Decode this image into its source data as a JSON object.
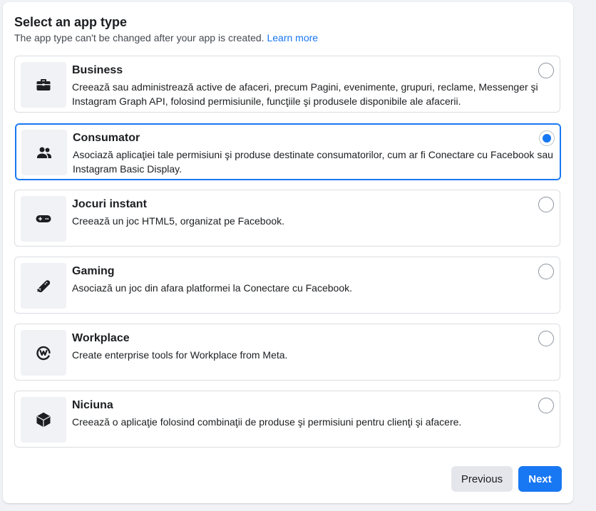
{
  "header": {
    "title": "Select an app type",
    "subtitle": "The app type can't be changed after your app is created.",
    "learn_more": "Learn more"
  },
  "options": [
    {
      "title": "Business",
      "description": "Creează sau administrează active de afaceri, precum Pagini, evenimente, grupuri, reclame, Messenger şi Instagram Graph API, folosind permisiunile, funcţiile şi produsele disponibile ale afacerii.",
      "icon": "briefcase-icon",
      "selected": false
    },
    {
      "title": "Consumator",
      "description": "Asociază aplicaţiei tale permisiuni şi produse destinate consumatorilor, cum ar fi Conectare cu Facebook sau Instagram Basic Display.",
      "icon": "people-icon",
      "selected": true
    },
    {
      "title": "Jocuri instant",
      "description": "Creează un joc HTML5, organizat pe Facebook.",
      "icon": "gamepad-icon",
      "selected": false
    },
    {
      "title": "Gaming",
      "description": "Asociază un joc din afara platformei la Conectare cu Facebook.",
      "icon": "joystick-icon",
      "selected": false
    },
    {
      "title": "Workplace",
      "description": "Create enterprise tools for Workplace from Meta.",
      "icon": "workplace-icon",
      "selected": false
    },
    {
      "title": "Niciuna",
      "description": "Creează o aplicaţie folosind combinaţii de produse şi permisiuni pentru clienţi şi afacere.",
      "icon": "cube-icon",
      "selected": false
    }
  ],
  "footer": {
    "previous_label": "Previous",
    "next_label": "Next"
  },
  "colors": {
    "accent": "#1877f2",
    "border": "#dadde1",
    "icon_bg": "#f0f2f5"
  }
}
